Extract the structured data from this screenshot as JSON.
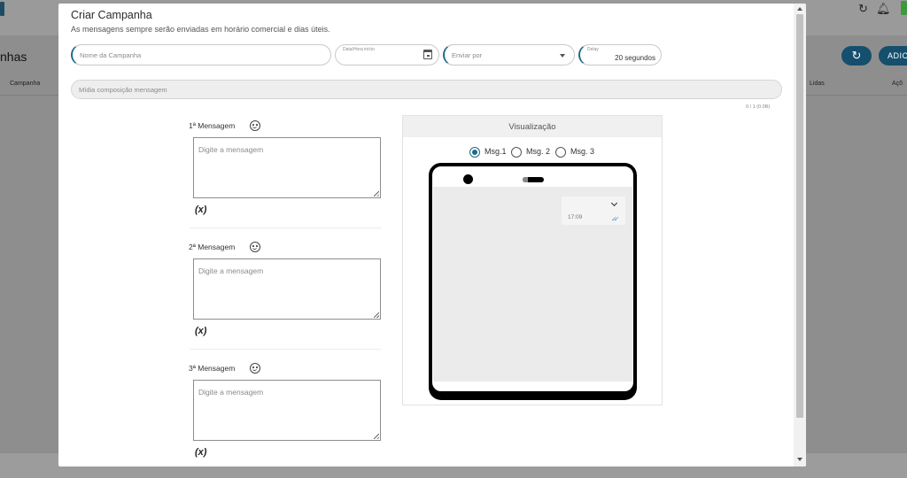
{
  "background": {
    "page_title_fragment": "nhas",
    "refresh_icon": "refresh-icon",
    "bell_icon": "bell-icon",
    "add_button_label": "ADIC",
    "columns": {
      "campanha": "Campanha",
      "lidas": "Lidas",
      "acoes": "Açõ"
    }
  },
  "modal": {
    "title": "Criar Campanha",
    "subtitle": "As mensagens sempre serão enviadas em horário comercial e dias úteis.",
    "fields": {
      "campaign_name_placeholder": "Nome da Campanha",
      "datetime_label": "Data/Hora início",
      "send_by_placeholder": "Enviar por",
      "delay_label": "Delay",
      "delay_value": "20 segundos",
      "media_placeholder": "Mídia composição mensagem",
      "media_counter": "0 / 1 (0.0B)"
    },
    "messages": [
      {
        "label": "1ª Mensagem",
        "placeholder": "Digite a mensagem",
        "var_button": "(x)"
      },
      {
        "label": "2ª Mensagem",
        "placeholder": "Digite a mensagem",
        "var_button": "(x)"
      },
      {
        "label": "3ª Mensagem",
        "placeholder": "Digite a mensagem",
        "var_button": "(x)"
      }
    ],
    "preview": {
      "title": "Visualização",
      "options": [
        "Msg.1",
        "Msg. 2",
        "Msg. 3"
      ],
      "selected": "Msg.1",
      "bubble_time": "17:09",
      "tick_color": "#4b8fd6"
    }
  },
  "colors": {
    "accent": "#1d6a8a",
    "brand_button": "#154f6d"
  }
}
